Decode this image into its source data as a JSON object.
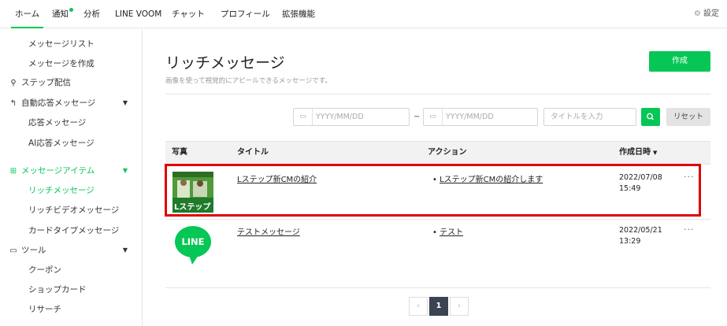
{
  "topnav": {
    "tabs": [
      {
        "label": "ホーム",
        "active": true
      },
      {
        "label": "通知",
        "dot": true
      },
      {
        "label": "分析"
      },
      {
        "label": "LINE VOOM"
      },
      {
        "label": "チャット"
      },
      {
        "label": "プロフィール"
      },
      {
        "label": "拡張機能"
      }
    ],
    "settings_label": "設定",
    "accent": "#06c755"
  },
  "sidebar": {
    "items": [
      {
        "label": "メッセージリスト"
      },
      {
        "label": "メッセージを作成"
      },
      {
        "label": "ステップ配信",
        "icon": "step-icon"
      },
      {
        "label": "自動応答メッセージ",
        "icon": "auto-reply-icon"
      },
      {
        "label": "応答メッセージ"
      },
      {
        "label": "AI応答メッセージ"
      },
      {
        "label": "メッセージアイテム",
        "icon": "message-item-icon"
      },
      {
        "label": "リッチメッセージ"
      },
      {
        "label": "リッチビデオメッセージ"
      },
      {
        "label": "カードタイプメッセージ"
      },
      {
        "label": "ツール",
        "icon": "tool-icon"
      },
      {
        "label": "クーポン"
      },
      {
        "label": "ショップカード"
      },
      {
        "label": "リサーチ"
      }
    ]
  },
  "main": {
    "title": "リッチメッセージ",
    "description": "画像を使って視覚的にアピールできるメッセージです。",
    "create_label": "作成",
    "filters": {
      "date_from_placeholder": "YYYY/MM/DD",
      "date_to_placeholder": "YYYY/MM/DD",
      "separator": "~",
      "title_placeholder": "タイトルを入力",
      "reset_label": "リセット"
    },
    "table": {
      "columns": [
        "写真",
        "タイトル",
        "アクション",
        "作成日時"
      ],
      "rows": [
        {
          "title": "Lステップ新CMの紹介",
          "action": "Lステップ新CMの紹介します",
          "date": "2022/07/08",
          "time": "15:49",
          "thumb_text": "Lステップ",
          "more": "···",
          "highlighted": true
        },
        {
          "title": "テストメッセージ",
          "action": "テスト",
          "date": "2022/05/21",
          "time": "13:29",
          "thumb_text": "LINE",
          "more": "···"
        }
      ]
    },
    "pagination": {
      "current": "1"
    }
  }
}
